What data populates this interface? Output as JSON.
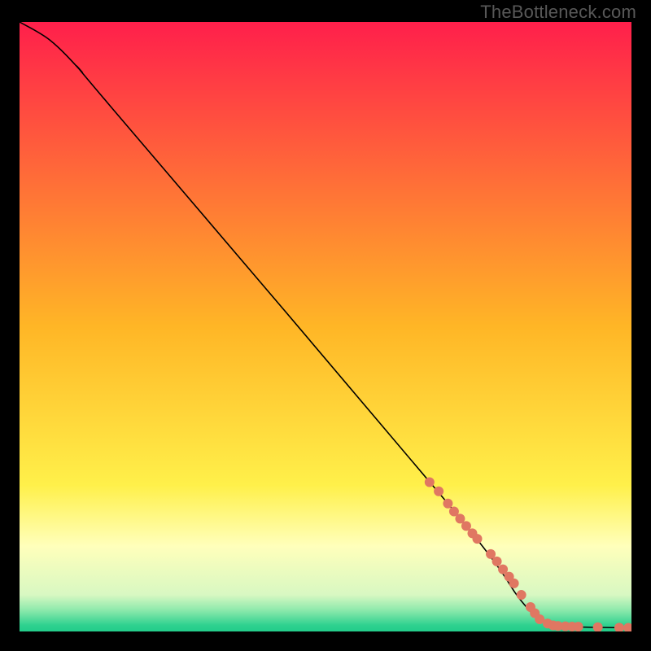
{
  "attribution": "TheBottleneck.com",
  "chart_data": {
    "type": "line",
    "title": "",
    "xlabel": "",
    "ylabel": "",
    "xlim": [
      0,
      100
    ],
    "ylim": [
      0,
      100
    ],
    "grid": false,
    "legend": false,
    "background": {
      "type": "vertical-gradient",
      "stops": [
        {
          "pos": 0.0,
          "color": "#ff1f4b"
        },
        {
          "pos": 0.5,
          "color": "#ffb626"
        },
        {
          "pos": 0.76,
          "color": "#fff04a"
        },
        {
          "pos": 0.86,
          "color": "#ffffbb"
        },
        {
          "pos": 0.94,
          "color": "#d8f8c2"
        },
        {
          "pos": 0.965,
          "color": "#8de9ac"
        },
        {
          "pos": 0.99,
          "color": "#2ed18f"
        },
        {
          "pos": 1.0,
          "color": "#23cc8a"
        }
      ]
    },
    "curve": {
      "comment": "Main black curve. y is the value (higher = higher on screen).",
      "points": [
        {
          "x": 0,
          "y": 100
        },
        {
          "x": 5,
          "y": 97
        },
        {
          "x": 10,
          "y": 92
        },
        {
          "x": 15,
          "y": 86
        },
        {
          "x": 70,
          "y": 21
        },
        {
          "x": 82,
          "y": 5
        },
        {
          "x": 86,
          "y": 1.5
        },
        {
          "x": 90,
          "y": 0.8
        },
        {
          "x": 100,
          "y": 0.6
        }
      ]
    },
    "markers": {
      "comment": "Salmon dots along the lower-right tail of the curve.",
      "color": "#e07762",
      "radius_px": 6,
      "points": [
        {
          "x": 67,
          "y": 24.5
        },
        {
          "x": 68.5,
          "y": 23
        },
        {
          "x": 70,
          "y": 21
        },
        {
          "x": 71,
          "y": 19.7
        },
        {
          "x": 72,
          "y": 18.5
        },
        {
          "x": 73,
          "y": 17.3
        },
        {
          "x": 74,
          "y": 16.1
        },
        {
          "x": 74.8,
          "y": 15.2
        },
        {
          "x": 77,
          "y": 12.7
        },
        {
          "x": 78,
          "y": 11.5
        },
        {
          "x": 79,
          "y": 10.2
        },
        {
          "x": 80,
          "y": 9.0
        },
        {
          "x": 80.8,
          "y": 7.9
        },
        {
          "x": 82,
          "y": 6.0
        },
        {
          "x": 83.5,
          "y": 4.0
        },
        {
          "x": 84.2,
          "y": 3.0
        },
        {
          "x": 85,
          "y": 2.0
        },
        {
          "x": 86.3,
          "y": 1.3
        },
        {
          "x": 87.2,
          "y": 1.0
        },
        {
          "x": 88,
          "y": 0.9
        },
        {
          "x": 89.2,
          "y": 0.85
        },
        {
          "x": 90.3,
          "y": 0.8
        },
        {
          "x": 91.3,
          "y": 0.78
        },
        {
          "x": 94.5,
          "y": 0.7
        },
        {
          "x": 98,
          "y": 0.62
        },
        {
          "x": 99.5,
          "y": 0.6
        }
      ]
    }
  }
}
